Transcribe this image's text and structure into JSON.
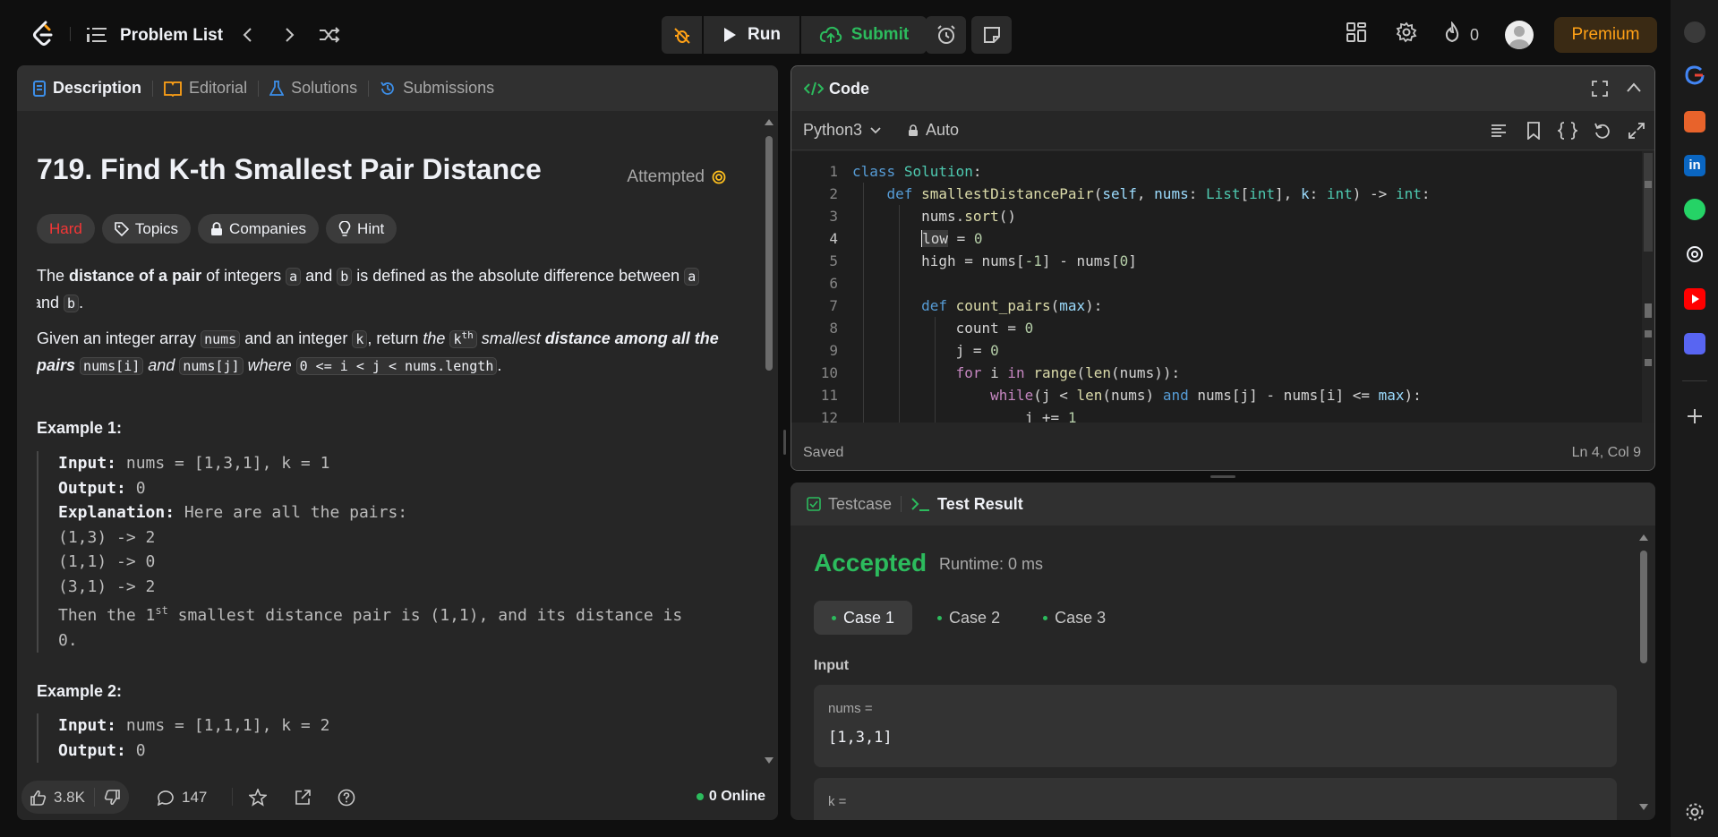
{
  "topbar": {
    "title": "Problem List",
    "run_label": "Run",
    "submit_label": "Submit",
    "streak_count": "0",
    "premium_label": "Premium"
  },
  "left_panel": {
    "tabs": [
      {
        "label": "Description"
      },
      {
        "label": "Editorial"
      },
      {
        "label": "Solutions"
      },
      {
        "label": "Submissions"
      }
    ],
    "question_title": "719. Find K-th Smallest Pair Distance",
    "status": "Attempted",
    "chips": {
      "difficulty": "Hard",
      "topics": "Topics",
      "companies": "Companies",
      "hint": "Hint"
    },
    "para1": {
      "t1": "The ",
      "b1": "distance of a pair",
      "t2": " of integers ",
      "c1": "a",
      "t3": " and ",
      "c2": "b",
      "t4": " is defined as the absolute difference between ",
      "c3": "a",
      "t5": " and ",
      "c4": "b",
      "t6": "."
    },
    "para2": {
      "t1": "Given an integer array ",
      "c1": "nums",
      "t2": " and an integer ",
      "c2": "k",
      "t3": ", return ",
      "i1": "the",
      "c3": "k",
      "sup": "th",
      "i2": "smallest",
      "b1": "distance among all the pairs",
      "c4": "nums[i]",
      "i3": "and",
      "c5": "nums[j]",
      "i4": "where",
      "c6": "0 <= i < j < nums.length",
      "t4": "."
    },
    "example1": {
      "title": "Example 1:",
      "input_label": "Input:",
      "input": " nums = [1,3,1], k = 1",
      "output_label": "Output:",
      "output": " 0",
      "explanation_label": "Explanation:",
      "explanation": " Here are all the pairs:",
      "lines": [
        "(1,3) -> 2",
        "(1,1) -> 0",
        "(3,1) -> 2"
      ],
      "then_pre": "Then the 1",
      "then_sup": "st",
      "then_post": " smallest distance pair is (1,1), and its distance is",
      "then_end": "0."
    },
    "example2": {
      "title": "Example 2:",
      "input_label": "Input:",
      "input": " nums = [1,1,1], k = 2",
      "output_label": "Output:",
      "output": " 0"
    },
    "footer": {
      "likes": "3.8K",
      "comments": "147",
      "online": "0 Online"
    }
  },
  "code_panel": {
    "title": "Code",
    "language": "Python3",
    "mode": "Auto",
    "status": "Saved",
    "cursor": "Ln 4, Col 9",
    "current_line": 4
  },
  "test_panel": {
    "tab_testcase": "Testcase",
    "tab_result": "Test Result",
    "verdict": "Accepted",
    "runtime": "Runtime: 0 ms",
    "cases": [
      "Case 1",
      "Case 2",
      "Case 3"
    ],
    "input_label": "Input",
    "inputs": [
      {
        "name": "nums =",
        "value": "[1,3,1]"
      },
      {
        "name": "k =",
        "value": ""
      }
    ]
  },
  "colors": {
    "accent": "#ffa116",
    "accepted": "#2cbb5d",
    "hard": "#f63636"
  }
}
